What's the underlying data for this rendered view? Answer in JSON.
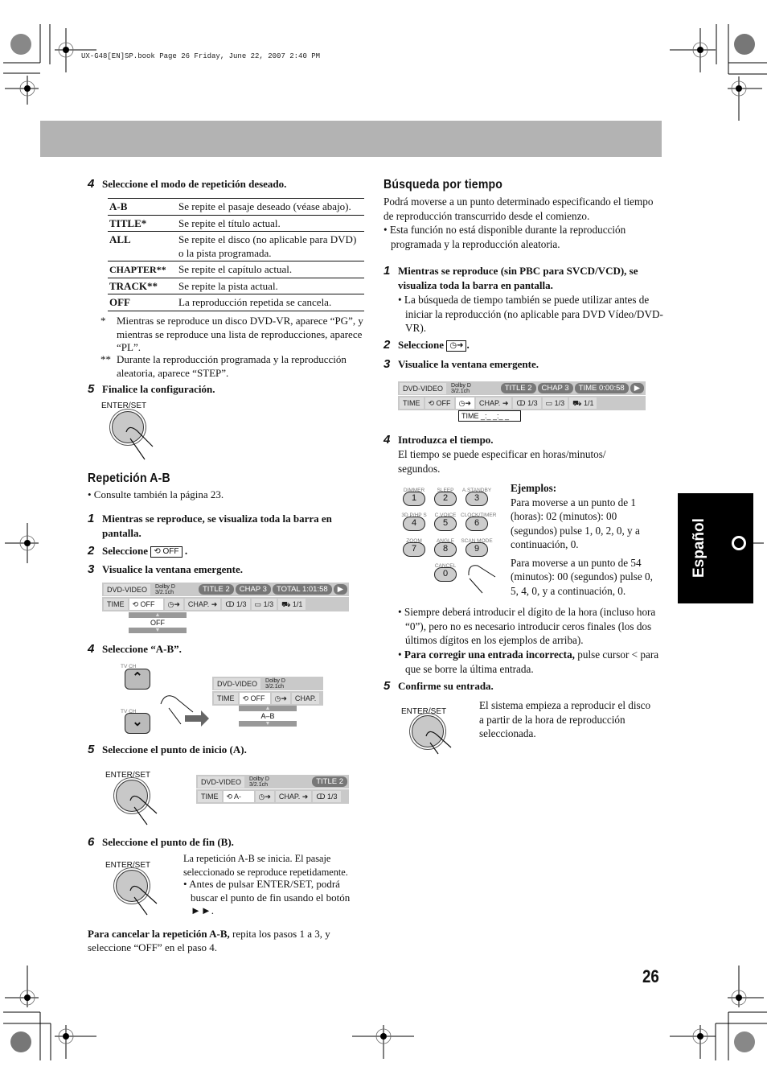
{
  "print_header": "UX-G48[EN]SP.book  Page 26  Friday, June 22, 2007  2:40 PM",
  "side_tab": {
    "label": "Español"
  },
  "page_number": "26",
  "left": {
    "step4": {
      "num": "4",
      "text": "Seleccione el modo de repetición deseado."
    },
    "repeat_table": [
      {
        "mode": "A-B",
        "desc": "Se repite el pasaje deseado (véase abajo)."
      },
      {
        "mode": "TITLE*",
        "desc": "Se repite el título actual."
      },
      {
        "mode": "ALL",
        "desc": "Se repite el disco (no aplicable para DVD) o la pista programada."
      },
      {
        "mode": "CHAPTER**",
        "desc": "Se repite el capítulo actual."
      },
      {
        "mode": "TRACK**",
        "desc": "Se repite la pista actual."
      },
      {
        "mode": "OFF",
        "desc": "La reproducción repetida se cancela."
      }
    ],
    "footnotes": [
      {
        "mark": "*",
        "text": "Mientras se reproduce un disco DVD-VR, aparece “PG”, y mientras se reproduce una lista de reproducciones, aparece “PL”."
      },
      {
        "mark": "**",
        "text": "Durante la reproducción programada y la reproducción aleatoria, aparece “STEP”."
      }
    ],
    "step5": {
      "num": "5",
      "text": "Finalice la configuración."
    },
    "enter_label": "ENTER/SET",
    "ab_section": {
      "title": "Repetición A-B",
      "ref": "• Consulte también la página 23.",
      "steps": [
        {
          "num": "1",
          "text": "Mientras se reproduce, se visualiza toda la barra en pantalla."
        },
        {
          "num": "2",
          "text": "Seleccione",
          "box": "OFF"
        },
        {
          "num": "3",
          "text": "Visualice la ventana emergente."
        },
        {
          "num": "4",
          "text": "Seleccione “A-B”."
        },
        {
          "num": "5",
          "text": "Seleccione el punto de inicio (A)."
        },
        {
          "num": "6",
          "text": "Seleccione el punto de fin (B)."
        }
      ],
      "tv_ch_up": "TV CH",
      "tv_ch_down": "TV CH",
      "step6_text": "La repetición A-B se inicia. El pasaje seleccionado se reproduce repetidamente.",
      "step6_bullet": "• Antes de pulsar ENTER/SET, podrá buscar el punto de fin usando el botón ►►.",
      "cancel_bold": "Para cancelar la repetición A-B,",
      "cancel_rest": " repita los pasos 1 a 3, y seleccione “OFF” en el paso 4."
    },
    "osd1": {
      "disc": "DVD-VIDEO",
      "audio1": "Dolby D",
      "audio2": "3/2.1ch",
      "title": "TITLE  2",
      "chap": "CHAP  3",
      "total": "TOTAL   1:01:58",
      "time": "TIME",
      "repeat": "OFF",
      "chap_btn": "CHAP.",
      "audio": "1/3",
      "sub": "1/3",
      "angle": "1/1",
      "popup": "OFF"
    },
    "osd2": {
      "disc": "DVD-VIDEO",
      "audio1": "Dolby D",
      "audio2": "3/2.1ch",
      "time": "TIME",
      "repeat": "OFF",
      "chap_btn": "CHAP.",
      "popup": "A–B"
    },
    "osd3": {
      "disc": "DVD-VIDEO",
      "audio1": "Dolby D",
      "audio2": "3/2.1ch",
      "title": "TITLE  2",
      "time": "TIME",
      "repeat": "A-",
      "chap_btn": "CHAP.",
      "audio": "1/3"
    }
  },
  "right": {
    "title": "Búsqueda por tiempo",
    "intro": "Podrá moverse a un punto determinado especificando el tiempo de reproducción transcurrido desde el comienzo.",
    "intro_bullet": "• Esta función no está disponible durante la reproducción programada y la reproducción aleatoria.",
    "steps": [
      {
        "num": "1",
        "text": "Mientras se reproduce (sin PBC para SVCD/VCD), se visualiza toda la barra en pantalla."
      },
      {
        "num": "2",
        "text": "Seleccione"
      },
      {
        "num": "3",
        "text": "Visualice la ventana emergente."
      },
      {
        "num": "4",
        "text": "Introduzca el tiempo."
      },
      {
        "num": "5",
        "text": "Confirme su entrada."
      }
    ],
    "step1_bullet": "• La búsqueda de tiempo también se puede utilizar antes de iniciar la reproducción (no aplicable para DVD Vídeo/DVD-VR).",
    "osd": {
      "disc": "DVD-VIDEO",
      "audio1": "Dolby D",
      "audio2": "3/2.1ch",
      "title": "TITLE  2",
      "chap": "CHAP  3",
      "time_disp": "TIME    0:00:58",
      "time": "TIME",
      "repeat": "OFF",
      "chap_btn": "CHAP.",
      "audio": "1/3",
      "sub": "1/3",
      "angle": "1/1",
      "popup": "TIME   _:_ _:_ _"
    },
    "step4_desc": "El tiempo se puede especificar en horas/minutos/ segundos.",
    "keypad": [
      {
        "label": "DIMMER",
        "key": "1"
      },
      {
        "label": "SLEEP",
        "key": "2"
      },
      {
        "label": "A.STANDBY",
        "key": "3"
      },
      {
        "label": "3D P/HP S",
        "key": "4"
      },
      {
        "label": "C.VOICE",
        "key": "5"
      },
      {
        "label": "CLOCK/TIMER",
        "key": "6"
      },
      {
        "label": "ZOOM",
        "key": "7"
      },
      {
        "label": "ANGLE",
        "key": "8"
      },
      {
        "label": "SCAN MODE",
        "key": "9"
      },
      {
        "label": "CANCEL",
        "key": "0"
      }
    ],
    "examples_title": "Ejemplos:",
    "example1": "Para moverse a un punto de 1 (horas): 02 (minutos): 00 (segundos) pulse 1, 0, 2, 0, y a continuación, 0.",
    "example2": "Para moverse a un punto de 54 (minutos): 00 (segundos) pulse 0, 5, 4, 0, y a continuación, 0.",
    "bullet1": "• Siempre deberá introducir el dígito de la hora (incluso hora “0”), pero no es necesario introducir ceros finales (los dos últimos dígitos en los ejemplos de arriba).",
    "bullet2_bold": "Para corregir una entrada incorrecta,",
    "bullet2_rest": " pulse cursor < para que se borre la última entrada.",
    "enter_label": "ENTER/SET",
    "step5_desc": "El sistema empieza a reproducir el disco a partir de la hora de reproducción seleccionada."
  }
}
